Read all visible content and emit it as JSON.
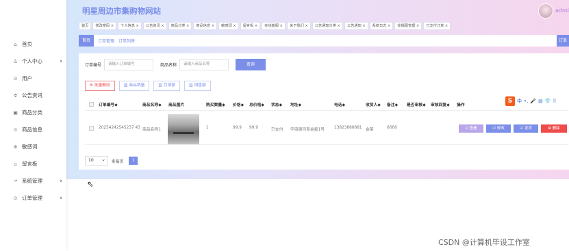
{
  "brand": {
    "title": "明星周边市集购物网站"
  },
  "user": {
    "name": "admin"
  },
  "sidebar": {
    "items": [
      {
        "label": "首页",
        "icon": "⌂",
        "arrow": ""
      },
      {
        "label": "个人中心",
        "icon": "♙",
        "arrow": "›"
      },
      {
        "label": "用户",
        "icon": "⊙",
        "arrow": ""
      },
      {
        "label": "公告资讯",
        "icon": "✲",
        "arrow": ""
      },
      {
        "label": "商品分类",
        "icon": "▣",
        "arrow": ""
      },
      {
        "label": "商品信息",
        "icon": "⊙",
        "arrow": ""
      },
      {
        "label": "敏感词",
        "icon": "⊕",
        "arrow": ""
      },
      {
        "label": "留言板",
        "icon": "⌂",
        "arrow": ""
      },
      {
        "label": "系统管理",
        "icon": "⬏",
        "arrow": "›"
      },
      {
        "label": "订单管理",
        "icon": "⊙",
        "arrow": "›"
      }
    ]
  },
  "tabs": [
    "首页",
    "修改密码 ×",
    "个人信息 ×",
    "公告资讯 ×",
    "商品分类 ×",
    "商品信息 ×",
    "敏感词 ×",
    "留言板 ×",
    "在线客服 ×",
    "关于我们 ×",
    "公告通知分类 ×",
    "公告通知 ×",
    "系统日志 ×",
    "轮播图管理 ×",
    "已支付订单 ×"
  ],
  "breadcrumb": {
    "home": "首页",
    "items": [
      "订单管理",
      "订单列表"
    ],
    "right": "订单"
  },
  "search": {
    "order_label": "订单编号",
    "order_placeholder": "请输入订单编号",
    "product_label": "商品名称",
    "product_placeholder": "请输入商品名称",
    "query_button": "查询"
  },
  "actions": {
    "batch_delete": "⊗ 批量删除",
    "product_sales": "▥ 商品销量",
    "monthly_sales": "▥ 月销额",
    "product_sales_amount": "▥ 销售额"
  },
  "table": {
    "headers": [
      "订单编号◆",
      "商品名称◆",
      "商品图片",
      "购买数量◆",
      "价格◆",
      "总价格◆",
      "状态◆",
      "地址◆",
      "电话◆",
      "收货人◆",
      "备注◆",
      "是否审核◆",
      "审核回复◆",
      "操作"
    ],
    "rows": [
      {
        "order_no": "20254242545237 43",
        "product": "商品名称1",
        "qty": "1",
        "price": "99.9",
        "total": "99.9",
        "status": "已支付",
        "address": "宇宙银河系金星1号",
        "phone": "13823888881",
        "receiver": "金菜",
        "remark": "6666",
        "btn_view": "⊙ 查看",
        "btn_edit": "☑ 修改",
        "btn_ship": "☑ 发货",
        "btn_delete": "⊠ 删除"
      }
    ]
  },
  "pager": {
    "page_size": "10",
    "per_page_label": "条每页",
    "current_page": "1"
  },
  "ime": {
    "logo": "S",
    "icons": [
      "中",
      "•,",
      "🎤",
      "▤",
      "👕",
      "⠿"
    ]
  },
  "watermark": "CSDN @计算机毕设工作室"
}
